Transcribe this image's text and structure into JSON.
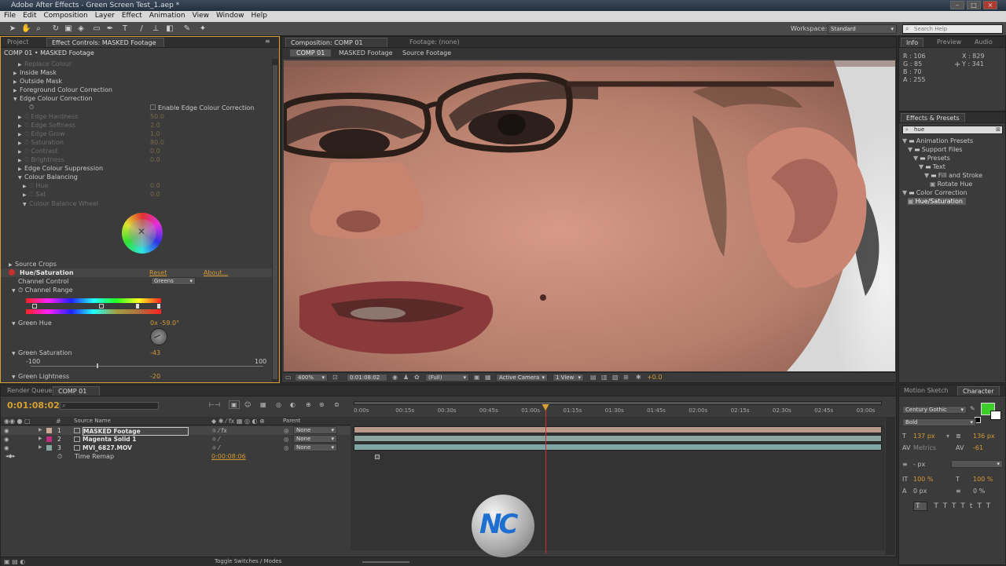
{
  "window": {
    "title": "Adobe After Effects - Green Screen Test_1.aep *"
  },
  "menu": [
    "File",
    "Edit",
    "Composition",
    "Layer",
    "Effect",
    "Animation",
    "View",
    "Window",
    "Help"
  ],
  "toolbar": {
    "workspace_label": "Workspace:",
    "workspace_value": "Standard",
    "search_placeholder": "Search Help"
  },
  "effect_controls": {
    "tab_project": "Project",
    "tab_effect": "Effect Controls: MASKED Footage",
    "breadcrumb": "COMP 01 • MASKED Footage",
    "items": [
      {
        "label": "Replace Colour",
        "indent": 2,
        "state": "dim"
      },
      {
        "label": "Inside Mask",
        "indent": 1,
        "state": "normal"
      },
      {
        "label": "Outside Mask",
        "indent": 1,
        "state": "normal"
      },
      {
        "label": "Foreground Colour Correction",
        "indent": 1,
        "state": "normal"
      },
      {
        "label": "Edge Colour Correction",
        "indent": 1,
        "state": "open"
      },
      {
        "label": "Enable Edge Colour Correction",
        "indent": 0,
        "state": "checkbox"
      },
      {
        "label": "Edge Hardness",
        "indent": 2,
        "state": "dim",
        "value": "50.0"
      },
      {
        "label": "Edge Softness",
        "indent": 2,
        "state": "dim",
        "value": "2.0"
      },
      {
        "label": "Edge Grow",
        "indent": 2,
        "state": "dim",
        "value": "1.0"
      },
      {
        "label": "Saturation",
        "indent": 2,
        "state": "dim",
        "value": "80.0"
      },
      {
        "label": "Contrast",
        "indent": 2,
        "state": "dim",
        "value": "0.0"
      },
      {
        "label": "Brightness",
        "indent": 2,
        "state": "dim",
        "value": "0.0"
      },
      {
        "label": "Edge Colour Suppression",
        "indent": 2,
        "state": "normal"
      },
      {
        "label": "Colour Balancing",
        "indent": 2,
        "state": "open"
      },
      {
        "label": "Hue",
        "indent": 3,
        "state": "dim",
        "value": "0.0"
      },
      {
        "label": "Sat",
        "indent": 3,
        "state": "dim",
        "value": "0.0"
      },
      {
        "label": "Colour Balance Wheel",
        "indent": 3,
        "state": "dimopen"
      }
    ],
    "source_crops": "Source Crops",
    "hue_sat": {
      "name": "Hue/Saturation",
      "reset": "Reset",
      "about": "About...",
      "channel_control_label": "Channel Control",
      "channel_control_value": "Greens",
      "channel_range_label": "Channel Range",
      "green_hue_label": "Green Hue",
      "green_hue_value": "0x -59.0°",
      "green_saturation_label": "Green Saturation",
      "green_saturation_value": "-43",
      "slider_min": "-100",
      "slider_max": "100",
      "green_saturation_level": -43,
      "green_lightness_label": "Green Lightness",
      "green_lightness_value": "-20"
    }
  },
  "composition": {
    "tab_comp": "Composition: COMP 01",
    "tab_footage": "Footage: (none)",
    "breadcrumbs": [
      "COMP 01",
      "MASKED Footage",
      "Source Footage"
    ],
    "footer": {
      "zoom": "400%",
      "timecode": "0:01:08:02",
      "resolution": "(Full)",
      "camera": "Active Camera",
      "view": "1 View",
      "exposure": "+0.0"
    }
  },
  "info": {
    "tabs": [
      "Info",
      "Preview",
      "Audio"
    ],
    "r": "R : 106",
    "g": "G : 85",
    "b": "B : 70",
    "a": "A : 255",
    "x": "X : 829",
    "y": "Y : 341",
    "swatch_color": "#6a5546"
  },
  "effects_presets": {
    "tab": "Effects & Presets",
    "search_value": "hue",
    "tree": [
      {
        "label": "Animation Presets",
        "level": 0,
        "type": "folder"
      },
      {
        "label": "Support Files",
        "level": 1,
        "type": "folder"
      },
      {
        "label": "Presets",
        "level": 2,
        "type": "folder"
      },
      {
        "label": "Text",
        "level": 3,
        "type": "folder"
      },
      {
        "label": "Fill and Stroke",
        "level": 4,
        "type": "folder"
      },
      {
        "label": "Rotate Hue",
        "level": 5,
        "type": "item"
      },
      {
        "label": "Color Correction",
        "level": 0,
        "type": "folder"
      },
      {
        "label": "Hue/Saturation",
        "level": 1,
        "type": "effect",
        "selected": true
      }
    ]
  },
  "timeline": {
    "tab_render": "Render Queue",
    "tab_comp": "COMP 01",
    "timecode": "0:01:08:02",
    "col_source": "Source Name",
    "col_parent": "Parent",
    "layers": [
      {
        "num": "1",
        "name": "MASKED Footage",
        "color": "#c8a896",
        "parent": "None",
        "bar": "#b9998a"
      },
      {
        "num": "2",
        "name": "Magenta Solid 1",
        "color": "#c03080",
        "parent": "None",
        "bar": "#8aa5a0"
      },
      {
        "num": "3",
        "name": "MVI_6827.MOV",
        "color": "#8aa5a0",
        "parent": "None",
        "bar": "#7fa6a4"
      }
    ],
    "time_remap_label": "Time Remap",
    "time_remap_value": "0:00:08:06",
    "ruler": [
      "0:00s",
      "00:15s",
      "00:30s",
      "00:45s",
      "01:00s",
      "01:15s",
      "01:30s",
      "01:45s",
      "02:00s",
      "02:15s",
      "02:30s",
      "02:45s",
      "03:00s"
    ],
    "playhead_seconds": 68,
    "toggle_label": "Toggle Switches / Modes"
  },
  "character": {
    "tabs": [
      "Motion Sketch",
      "Character"
    ],
    "font": "Century Gothic",
    "style": "Bold",
    "size": "137 px",
    "leading": "136 px",
    "kerning": "Metrics",
    "tracking": "-61",
    "stroke": "- px",
    "vscale": "100 %",
    "hscale": "100 %",
    "baseline": "0 px",
    "tsume": "0 %",
    "fill_color": "#3ccf2a"
  },
  "watermark": {
    "text": "NC"
  }
}
